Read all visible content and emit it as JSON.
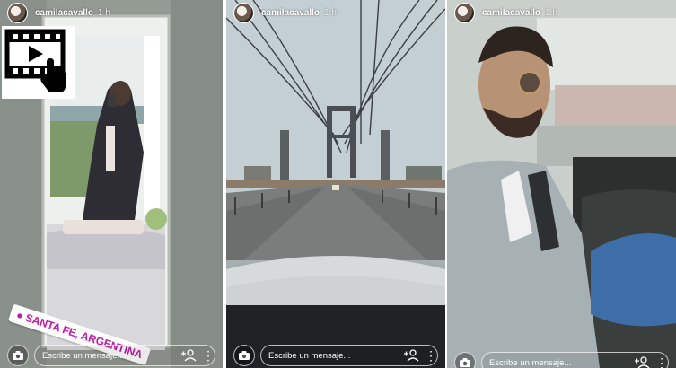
{
  "stories": [
    {
      "username": "camilacavallo",
      "time": "1 h",
      "location_sticker": "SANTA FE, ARGENTINA",
      "message_placeholder": "Escribe un mensaje..."
    },
    {
      "username": "camilacavallo",
      "time": "1 h",
      "message_placeholder": "Escribe un mensaje..."
    },
    {
      "username": "camilacavallo",
      "time": "1 h",
      "message_placeholder": "Escribe un mensaje..."
    }
  ],
  "icons": {
    "video_badge": "video-play-tap-icon",
    "camera": "camera-icon",
    "add_person": "add-person-icon",
    "more": "more-dots-icon"
  },
  "colors": {
    "sticker_text": "#c11ba3",
    "ui_text": "#ffffff"
  }
}
